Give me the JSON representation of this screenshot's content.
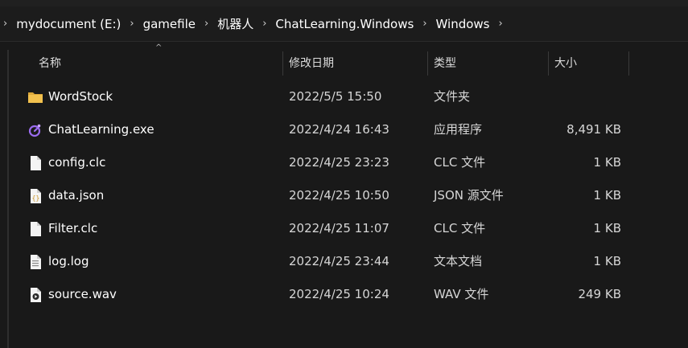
{
  "breadcrumb": {
    "items": [
      "mydocument (E:)",
      "gamefile",
      "机器人",
      "ChatLearning.Windows",
      "Windows"
    ]
  },
  "columns": {
    "name": "名称",
    "date": "修改日期",
    "type": "类型",
    "size": "大小"
  },
  "files": [
    {
      "name": "WordStock",
      "date": "2022/5/5 15:50",
      "type": "文件夹",
      "size": "",
      "icon": "folder-icon"
    },
    {
      "name": "ChatLearning.exe",
      "date": "2022/4/24 16:43",
      "type": "应用程序",
      "size": "8,491 KB",
      "icon": "app-icon"
    },
    {
      "name": "config.clc",
      "date": "2022/4/25 23:23",
      "type": "CLC 文件",
      "size": "1 KB",
      "icon": "file-icon"
    },
    {
      "name": "data.json",
      "date": "2022/4/25 10:50",
      "type": "JSON 源文件",
      "size": "1 KB",
      "icon": "json-file-icon"
    },
    {
      "name": "Filter.clc",
      "date": "2022/4/25 11:07",
      "type": "CLC 文件",
      "size": "1 KB",
      "icon": "file-icon"
    },
    {
      "name": "log.log",
      "date": "2022/4/25 23:44",
      "type": "文本文档",
      "size": "1 KB",
      "icon": "text-file-icon"
    },
    {
      "name": "source.wav",
      "date": "2022/4/25 10:24",
      "type": "WAV 文件",
      "size": "249 KB",
      "icon": "audio-file-icon"
    }
  ],
  "colors": {
    "background": "#191919",
    "folder": "#f2c14e",
    "app_accent": "#9b6cf0"
  }
}
